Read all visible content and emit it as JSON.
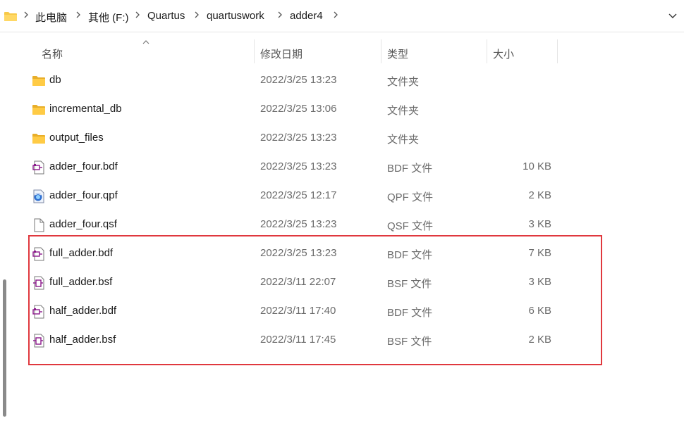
{
  "breadcrumb": {
    "icon": "folder-icon",
    "items": [
      "此电脑",
      "其他 (F:)",
      "Quartus",
      "quartuswork",
      "adder4"
    ]
  },
  "columns": {
    "name": "名称",
    "date": "修改日期",
    "type": "类型",
    "size": "大小"
  },
  "files": [
    {
      "name": "db",
      "date": "2022/3/25 13:23",
      "type": "文件夹",
      "size": "",
      "icon": "folder-icon"
    },
    {
      "name": "incremental_db",
      "date": "2022/3/25 13:06",
      "type": "文件夹",
      "size": "",
      "icon": "folder-icon"
    },
    {
      "name": "output_files",
      "date": "2022/3/25 13:23",
      "type": "文件夹",
      "size": "",
      "icon": "folder-icon"
    },
    {
      "name": "adder_four.bdf",
      "date": "2022/3/25 13:23",
      "type": "BDF 文件",
      "size": "10 KB",
      "icon": "bdf-file-icon"
    },
    {
      "name": "adder_four.qpf",
      "date": "2022/3/25 12:17",
      "type": "QPF 文件",
      "size": "2 KB",
      "icon": "qpf-file-icon"
    },
    {
      "name": "adder_four.qsf",
      "date": "2022/3/25 13:23",
      "type": "QSF 文件",
      "size": "3 KB",
      "icon": "blank-file-icon"
    },
    {
      "name": "full_adder.bdf",
      "date": "2022/3/25 13:23",
      "type": "BDF 文件",
      "size": "7 KB",
      "icon": "bdf-file-icon"
    },
    {
      "name": "full_adder.bsf",
      "date": "2022/3/11 22:07",
      "type": "BSF 文件",
      "size": "3 KB",
      "icon": "bsf-file-icon"
    },
    {
      "name": "half_adder.bdf",
      "date": "2022/3/11 17:40",
      "type": "BDF 文件",
      "size": "6 KB",
      "icon": "bdf-file-icon"
    },
    {
      "name": "half_adder.bsf",
      "date": "2022/3/11 17:45",
      "type": "BSF 文件",
      "size": "2 KB",
      "icon": "bsf-file-icon"
    }
  ],
  "colors": {
    "highlight": "#e0383e",
    "folder": "#f7c948",
    "bdf_accent": "#8b1a8b"
  }
}
